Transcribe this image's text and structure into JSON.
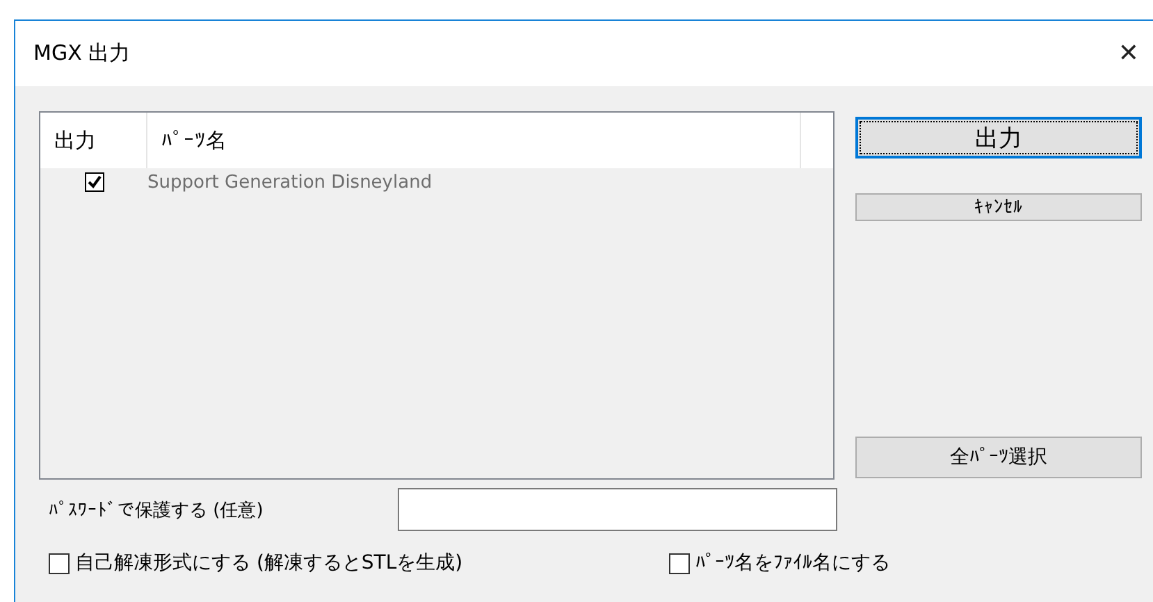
{
  "window": {
    "title": "MGX 出力",
    "close": "✕"
  },
  "table": {
    "columns": [
      "出力",
      "ﾊﾟｰﾂ名"
    ],
    "rows": [
      {
        "checked": true,
        "name": "Support Generation Disneyland"
      }
    ]
  },
  "buttons": [
    {
      "label": "出力",
      "focused": true
    },
    {
      "label": "ｷｬﾝｾﾙ",
      "focused": false
    }
  ],
  "select_all_button": {
    "label": "全ﾊﾟｰﾂ選択"
  },
  "password": {
    "label": "ﾊﾟｽﾜｰﾄﾞで保護する (任意)"
  },
  "options": [
    {
      "label": "自己解凍形式にする (解凍するとSTLを生成)",
      "checked": false
    },
    {
      "label": "ﾊﾟｰﾂ名をﾌｧｲﾙ名にする",
      "checked": false
    }
  ]
}
